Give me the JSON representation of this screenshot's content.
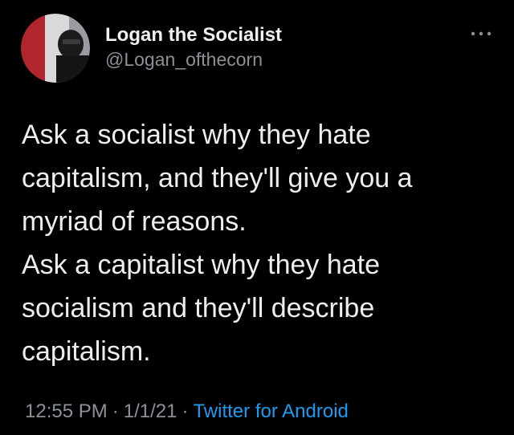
{
  "author": {
    "display_name": "Logan the Socialist",
    "handle": "@Logan_ofthecorn",
    "avatar_icon": "avatar-photo-icon"
  },
  "actions": {
    "more_icon": "more-options-icon"
  },
  "tweet": {
    "lines": [
      "Ask a socialist why they hate",
      "capitalism, and they'll give you a",
      "myriad of reasons.",
      "Ask a capitalist why they hate",
      "socialism and they'll describe",
      "capitalism."
    ]
  },
  "meta": {
    "time": "12:55 PM",
    "separator": "·",
    "date": "1/1/21",
    "source": "Twitter for Android"
  },
  "colors": {
    "background": "#000000",
    "primary_text": "#eceeef",
    "secondary_text": "#8b9197",
    "link": "#1d9bf0"
  }
}
